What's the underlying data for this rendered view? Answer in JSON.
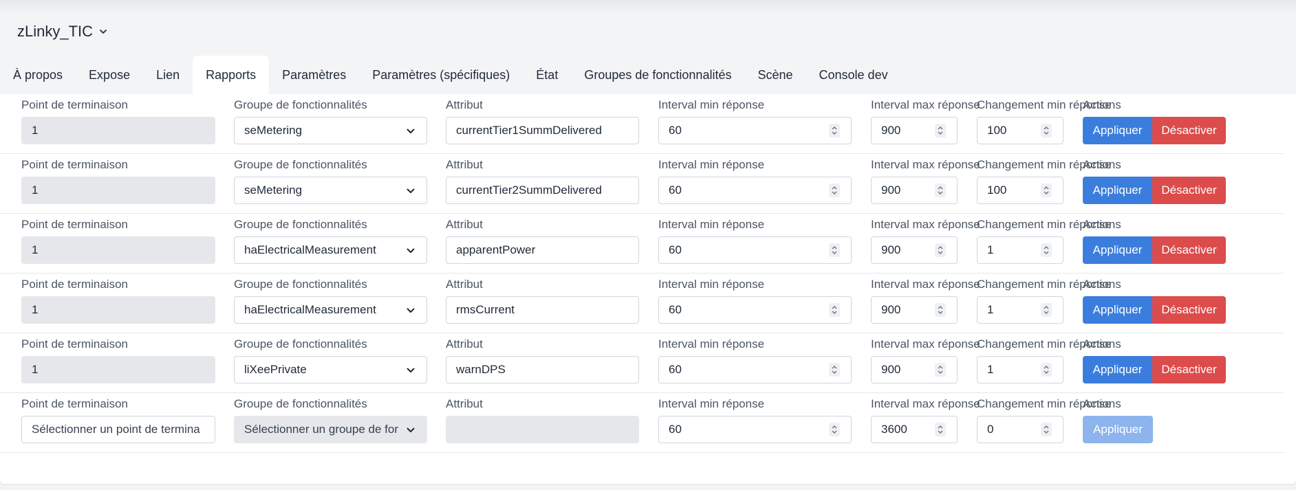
{
  "device": {
    "name": "zLinky_TIC"
  },
  "tabs": [
    {
      "label": "À propos",
      "active": false
    },
    {
      "label": "Expose",
      "active": false
    },
    {
      "label": "Lien",
      "active": false
    },
    {
      "label": "Rapports",
      "active": true
    },
    {
      "label": "Paramètres",
      "active": false
    },
    {
      "label": "Paramètres (spécifiques)",
      "active": false
    },
    {
      "label": "État",
      "active": false
    },
    {
      "label": "Groupes de fonctionnalités",
      "active": false
    },
    {
      "label": "Scène",
      "active": false
    },
    {
      "label": "Console dev",
      "active": false
    }
  ],
  "labels": {
    "endpoint": "Point de terminaison",
    "cluster": "Groupe de fonctionnalités",
    "attribute": "Attribut",
    "min_interval": "Interval min réponse",
    "max_interval": "Interval max réponse",
    "min_change": "Changement min réponse",
    "actions": "Actions",
    "apply": "Appliquer",
    "disable": "Désactiver"
  },
  "reports": [
    {
      "endpoint": "1",
      "cluster": "seMetering",
      "attribute": "currentTier1SummDelivered",
      "min_interval": "60",
      "max_interval": "900",
      "min_change": "100"
    },
    {
      "endpoint": "1",
      "cluster": "seMetering",
      "attribute": "currentTier2SummDelivered",
      "min_interval": "60",
      "max_interval": "900",
      "min_change": "100"
    },
    {
      "endpoint": "1",
      "cluster": "haElectricalMeasurement",
      "attribute": "apparentPower",
      "min_interval": "60",
      "max_interval": "900",
      "min_change": "1"
    },
    {
      "endpoint": "1",
      "cluster": "haElectricalMeasurement",
      "attribute": "rmsCurrent",
      "min_interval": "60",
      "max_interval": "900",
      "min_change": "1"
    },
    {
      "endpoint": "1",
      "cluster": "liXeePrivate",
      "attribute": "warnDPS",
      "min_interval": "60",
      "max_interval": "900",
      "min_change": "1"
    }
  ],
  "new_report": {
    "endpoint_placeholder": "Sélectionner un point de termina",
    "cluster_placeholder": "Sélectionner un groupe de for",
    "attribute": "",
    "min_interval": "60",
    "max_interval": "3600",
    "min_change": "0"
  },
  "icons": {
    "dropdown": "chevron-down-icon",
    "spinner": "spinner-arrows-icon"
  },
  "colors": {
    "apply": "#3b7ddd",
    "apply_disabled": "#8db4ec",
    "disable": "#dc4c4c"
  }
}
